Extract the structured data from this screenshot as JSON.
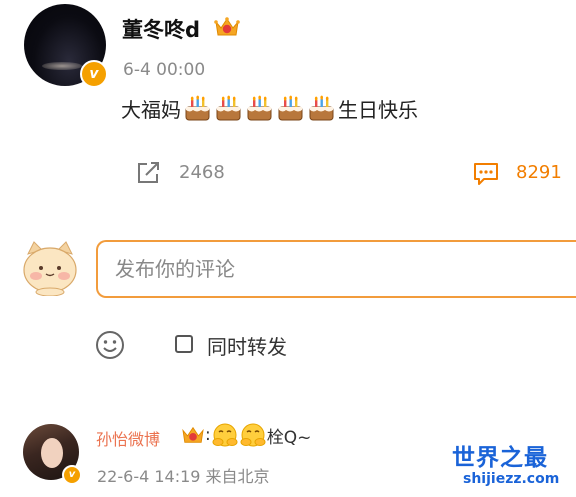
{
  "post": {
    "author": "董冬咚d",
    "time": "6-4 00:00",
    "text_before": "大福妈",
    "cake_count": 5,
    "text_after": "生日快乐"
  },
  "actions": {
    "share_count": "2468",
    "comment_count": "8291"
  },
  "comment_box": {
    "placeholder": "发布你的评论",
    "repost_label": "同时转发"
  },
  "reply": {
    "user": "孙怡微博",
    "separator": ":",
    "text": "栓Q~",
    "time": "22-6-4 14:19 来自北京"
  },
  "watermark": {
    "title": "世界之最",
    "url": "shijiezz.com"
  },
  "colors": {
    "accent": "#f27e00",
    "verified": "#f5a000",
    "reply_name": "#eb7350",
    "watermark": "#1a63d8"
  },
  "icons": [
    "crown-icon",
    "cake-emoji",
    "share-icon",
    "comment-icon",
    "emoji-icon",
    "verified-icon"
  ]
}
